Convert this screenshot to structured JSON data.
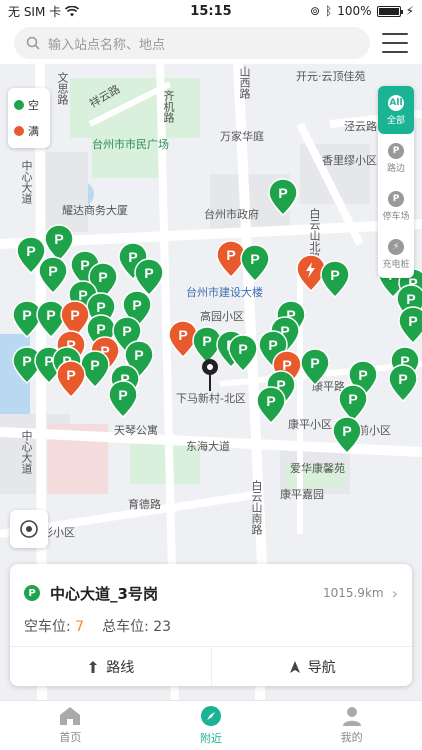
{
  "status": {
    "carrier": "无 SIM 卡",
    "time": "15:15",
    "battery": "100%"
  },
  "search": {
    "placeholder": "输入站点名称、地点"
  },
  "legend": [
    {
      "label": "空",
      "color": "#1fa34a"
    },
    {
      "label": "满",
      "color": "#e85a2c"
    }
  ],
  "filters": [
    {
      "icon": "All",
      "label": "全部",
      "active": true
    },
    {
      "icon": "P",
      "label": "路边",
      "active": false
    },
    {
      "icon": "P",
      "label": "停车场",
      "active": false
    },
    {
      "icon": "⚡",
      "label": "充电桩",
      "active": false
    }
  ],
  "map_labels": {
    "wenhui": "文思路",
    "yanggang": "祥云路",
    "shimin": "台州市市民广场",
    "yunding": "开元·云顶佳苑",
    "wanjia": "万家华庭",
    "jingfeng": "泾云路",
    "xiangli": "香里缪小区",
    "yaoda": "耀达商务大厦",
    "zhengfu": "台州市政府",
    "jianshe": "台州市建设大楼",
    "gaoyuan": "高园小区",
    "xiama": "下马新村-北区",
    "tianqin": "天琴公寓",
    "donghai": "东海大道",
    "kangping": "康平小区",
    "kangping_road": "康平路",
    "aihua": "爱华康馨苑",
    "kangping_jiayuan": "康平嘉园",
    "yude": "育德路",
    "baiyunshan": "白云山南路",
    "zhongxin": "中心大道",
    "baiyun_north": "白云山北路",
    "caixiao": "彩小区",
    "qianxiao": "前小区",
    "shanxi": "山西路",
    "qianji": "齐机路"
  },
  "card": {
    "name": "中心大道_3号岗",
    "distance": "1015.9km",
    "free_label": "空车位:",
    "free_value": "7",
    "total_label": "总车位:",
    "total_value": "23",
    "route_label": "路线",
    "nav_label": "导航"
  },
  "tabs": [
    {
      "label": "首页",
      "active": false
    },
    {
      "label": "附近",
      "active": true
    },
    {
      "label": "我的",
      "active": false
    }
  ]
}
